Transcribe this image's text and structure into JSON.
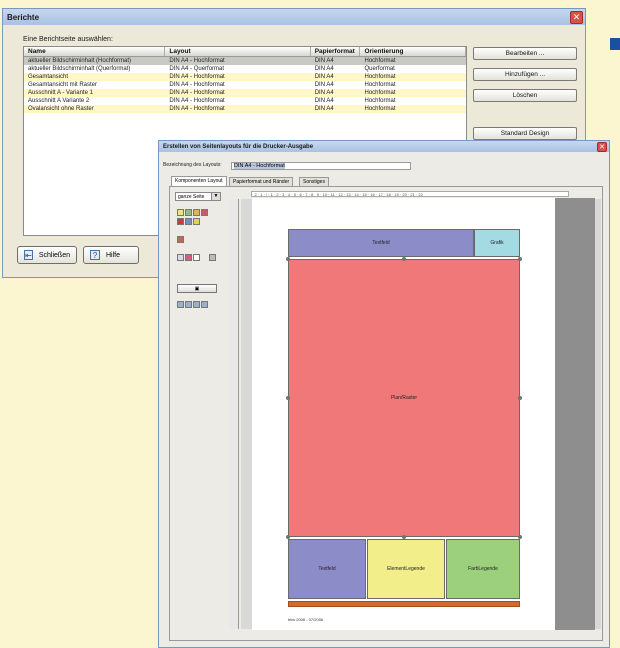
{
  "berichte_window": {
    "title": "Berichte",
    "close_symbol": "✕",
    "prompt": "Eine Berichtseite auswählen:",
    "columns": [
      "Name",
      "Layout",
      "Papierformat",
      "Orientierung"
    ],
    "rows": [
      {
        "name": "aktueller Bildschirminhalt (Hochformat)",
        "layout": "DIN A4 - Hochformat",
        "paper": "DIN A4",
        "orientation": "Hochformat"
      },
      {
        "name": "aktueller Bildschirminhalt (Querformat)",
        "layout": "DIN A4 - Querformat",
        "paper": "DIN A4",
        "orientation": "Querformat"
      },
      {
        "name": "Gesamtansicht",
        "layout": "DIN A4 - Hochformat",
        "paper": "DIN A4",
        "orientation": "Hochformat"
      },
      {
        "name": "Gesamtansicht mit Raster",
        "layout": "DIN A4 - Hochformat",
        "paper": "DIN A4",
        "orientation": "Hochformat"
      },
      {
        "name": "Ausschnitt A - Variante 1",
        "layout": "DIN A4 - Hochformat",
        "paper": "DIN A4",
        "orientation": "Hochformat"
      },
      {
        "name": "Ausschnitt A Variante 2",
        "layout": "DIN A4 - Hochformat",
        "paper": "DIN A4",
        "orientation": "Hochformat"
      },
      {
        "name": "Ovalansicht ohne Raster",
        "layout": "DIN A4 - Hochformat",
        "paper": "DIN A4",
        "orientation": "Hochformat"
      }
    ],
    "buttons": {
      "edit": "Bearbeiten ...",
      "add": "Hinzufügen ...",
      "delete": "Löschen",
      "standard": "Standard Design"
    },
    "bottom_buttons": {
      "close": "Schließen",
      "help": "Hilfe"
    }
  },
  "designer_window": {
    "title": "Erstellen von Seitenlayouts für die Drucker-Ausgabe",
    "close_symbol": "✕",
    "name_label": "Bezeichnung des Layouts:",
    "name_value": "DIN A4 - Hochformat",
    "tabs": [
      "Komponenten Layout",
      "Papierformat und Ränder",
      "Sonstiges"
    ],
    "zoom_value": "ganze Seite",
    "components": {
      "textfeld_top": "Textfeld",
      "grafik": "Grafik",
      "plan": "Plan/Raster",
      "textfeld_bottom": "Textfeld",
      "element_legende": "ElementLegende",
      "farb_legende": "FarbLegende"
    },
    "footer_text": "bkw 2006 - 07/2006"
  },
  "colors": {
    "background": "#fbf6cf",
    "textfeld": "#8c8cc9",
    "grafik": "#a4dbe3",
    "plan": "#f07878",
    "element_legende": "#f2ee8a",
    "farb_legende": "#9cd07c",
    "footer_bar": "#d2692e"
  }
}
